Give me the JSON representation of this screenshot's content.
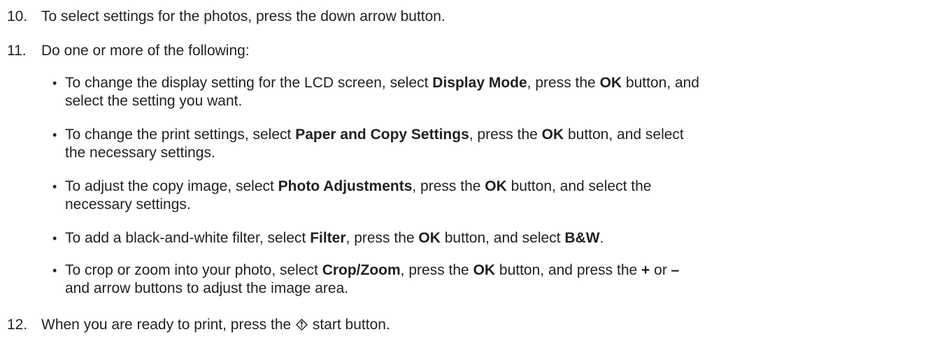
{
  "steps": [
    {
      "number": "10.",
      "text": "To select settings for the photos, press the down arrow button."
    },
    {
      "number": "11.",
      "text": "Do one or more of the following:"
    },
    {
      "number": "12.",
      "text_before": "When you are ready to print, press the",
      "text_after": "start button.",
      "icon": "start-diamond-icon"
    }
  ],
  "bullets": [
    {
      "dot": "•",
      "p1": "To change the display setting for the LCD screen, select ",
      "b1": "Display Mode",
      "p2": ", press the ",
      "b2": "OK",
      "p3": " button, and",
      "line2": "select the setting you want."
    },
    {
      "dot": "•",
      "p1": "To change the print settings, select ",
      "b1": "Paper and Copy Settings",
      "p2": ", press the ",
      "b2": "OK",
      "p3": " button, and select",
      "line2": "the necessary settings."
    },
    {
      "dot": "•",
      "p1": "To adjust the copy image, select ",
      "b1": "Photo Adjustments",
      "p2": ", press the ",
      "b2": "OK",
      "p3": " button, and select the",
      "line2": "necessary settings."
    },
    {
      "dot": "•",
      "p1": "To add a black-and-white filter, select ",
      "b1": "Filter",
      "p2": ", press the ",
      "b2": "OK",
      "p3": " button, and select ",
      "b3": "B&W",
      "p4": "."
    },
    {
      "dot": "•",
      "p1": "To crop or zoom into your photo, select ",
      "b1": "Crop/Zoom",
      "p2": ", press the ",
      "b2": "OK",
      "p3": " button, and press the ",
      "b3": "+",
      "p4": " or ",
      "b4": "–",
      "line2": "and arrow buttons to adjust the image area."
    }
  ]
}
